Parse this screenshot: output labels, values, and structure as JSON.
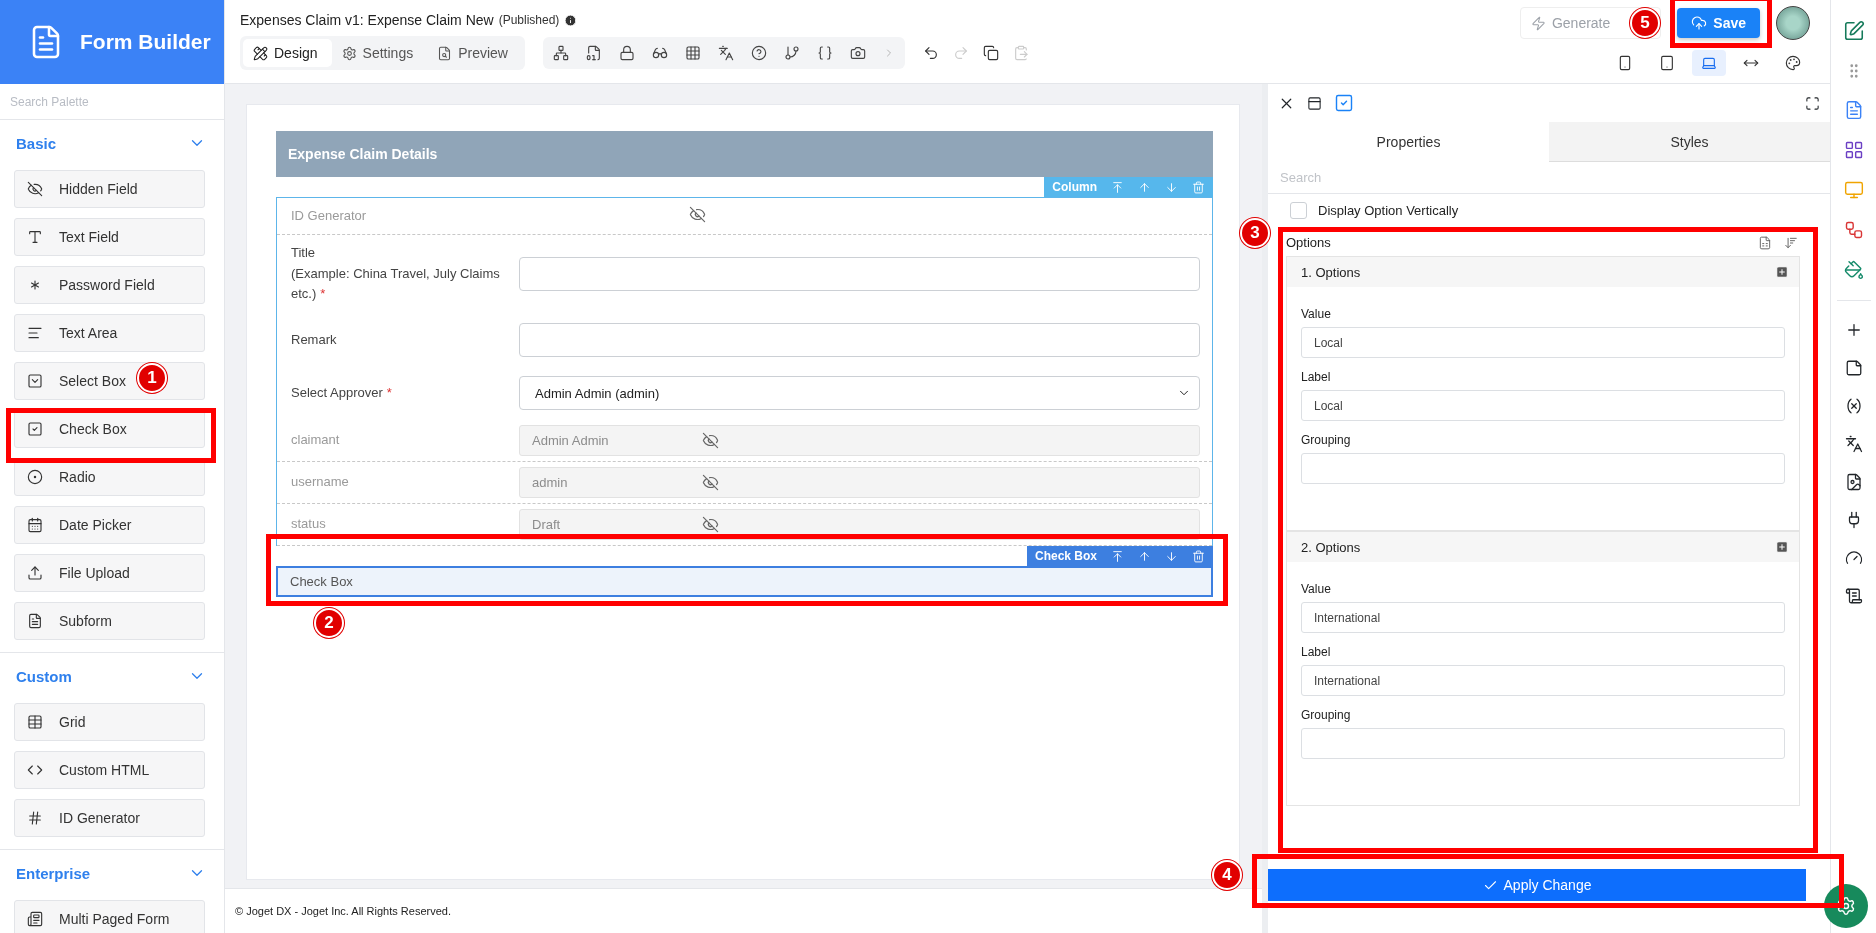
{
  "app": {
    "title": "Form Builder"
  },
  "palette": {
    "search_placeholder": "Search Palette",
    "sections": [
      {
        "title": "Basic",
        "expanded": true,
        "items": [
          {
            "label": "Hidden Field",
            "kind": "hidden"
          },
          {
            "label": "Text Field",
            "kind": "text"
          },
          {
            "label": "Password Field",
            "kind": "password"
          },
          {
            "label": "Text Area",
            "kind": "textarea"
          },
          {
            "label": "Select Box",
            "kind": "select"
          },
          {
            "label": "Check Box",
            "kind": "checkbox"
          },
          {
            "label": "Radio",
            "kind": "radio"
          },
          {
            "label": "Date Picker",
            "kind": "date"
          },
          {
            "label": "File Upload",
            "kind": "upload"
          },
          {
            "label": "Subform",
            "kind": "subform"
          }
        ]
      },
      {
        "title": "Custom",
        "expanded": true,
        "items": [
          {
            "label": "Grid",
            "kind": "grid"
          },
          {
            "label": "Custom HTML",
            "kind": "html"
          },
          {
            "label": "ID Generator",
            "kind": "idgen"
          }
        ]
      },
      {
        "title": "Enterprise",
        "expanded": true,
        "items": [
          {
            "label": "Multi Paged Form",
            "kind": "multipage"
          }
        ]
      }
    ]
  },
  "header": {
    "title": "Expenses Claim v1: Expense Claim New",
    "status": "(Published)",
    "tabs": [
      {
        "label": "Design",
        "kind": "design",
        "selected": true
      },
      {
        "label": "Settings",
        "kind": "settings",
        "selected": false
      },
      {
        "label": "Preview",
        "kind": "preview",
        "selected": false
      }
    ],
    "generate_button": {
      "label": "Generate",
      "disabled": true
    },
    "save_button": {
      "label": "Save"
    },
    "devices": [
      {
        "kind": "phone",
        "selected": false
      },
      {
        "kind": "tablet",
        "selected": false
      },
      {
        "kind": "laptop",
        "selected": true
      },
      {
        "kind": "wide",
        "selected": false
      },
      {
        "kind": "palette",
        "selected": false
      }
    ]
  },
  "form": {
    "section_title": "Expense Claim Details",
    "column_toolbar": "Column",
    "fields": [
      {
        "kind": "idgen",
        "label": "ID Generator"
      },
      {
        "kind": "text",
        "label": "Title",
        "hint": "(Example: China Travel, July Claims etc.)",
        "required_mark": "*"
      },
      {
        "kind": "text",
        "label": "Remark"
      },
      {
        "kind": "select",
        "label": "Select Approver",
        "required_mark": "*",
        "value": "Admin Admin (admin)"
      },
      {
        "kind": "readonly",
        "label": "claimant",
        "value": "Admin Admin"
      },
      {
        "kind": "readonly",
        "label": "username",
        "value": "admin"
      },
      {
        "kind": "readonly",
        "label": "status",
        "value": "Draft"
      }
    ],
    "selected_element": {
      "toolbar": "Check Box",
      "label": "Check Box"
    }
  },
  "footer": "© Joget DX - Joget Inc. All Rights Reserved.",
  "properties": {
    "tabs": [
      {
        "label": "Properties",
        "selected": true
      },
      {
        "label": "Styles",
        "selected": false
      }
    ],
    "search_placeholder": "Search",
    "display_vertically": {
      "label": "Display Option Vertically",
      "checked": false
    },
    "options_title": "Options",
    "options": [
      {
        "title": "1. Options",
        "fields": [
          {
            "label": "Value",
            "value": "Local"
          },
          {
            "label": "Label",
            "value": "Local"
          },
          {
            "label": "Grouping"
          }
        ]
      },
      {
        "title": "2. Options",
        "fields": [
          {
            "label": "Value",
            "value": "International"
          },
          {
            "label": "Label",
            "value": "International"
          },
          {
            "label": "Grouping"
          }
        ]
      }
    ],
    "apply_button": "Apply Change"
  },
  "annotations": [
    {
      "label": "1"
    },
    {
      "label": "2"
    },
    {
      "label": "3"
    },
    {
      "label": "4"
    },
    {
      "label": "5"
    }
  ]
}
